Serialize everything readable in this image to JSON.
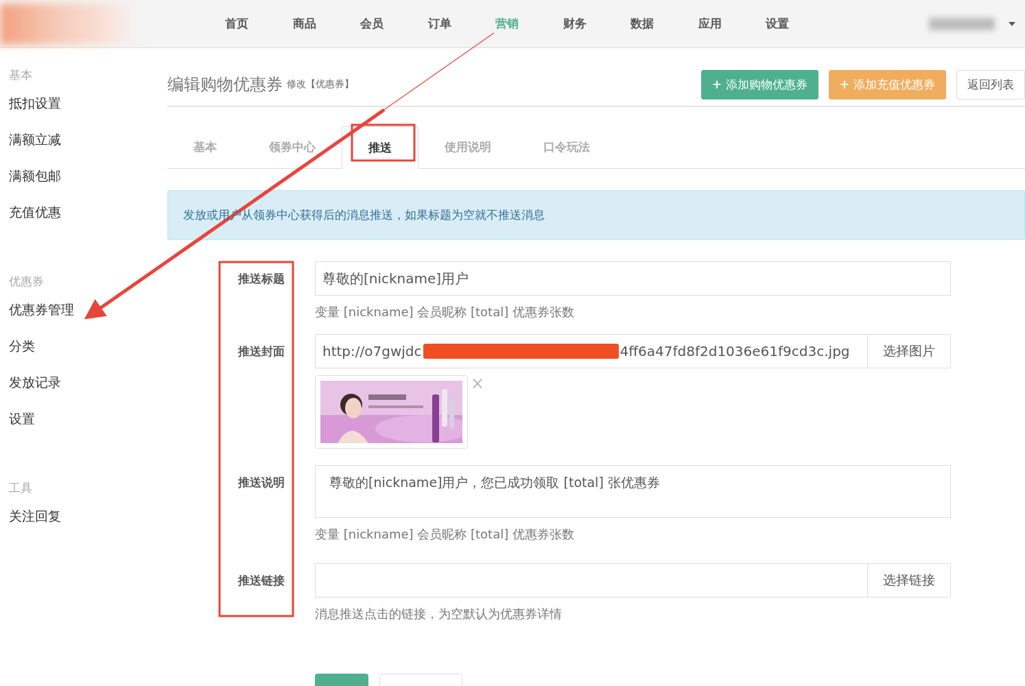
{
  "nav": {
    "items": [
      {
        "label": "首页",
        "selected": false
      },
      {
        "label": "商品",
        "selected": false
      },
      {
        "label": "会员",
        "selected": false
      },
      {
        "label": "订单",
        "selected": false
      },
      {
        "label": "营销",
        "selected": true
      },
      {
        "label": "财务",
        "selected": false
      },
      {
        "label": "数据",
        "selected": false
      },
      {
        "label": "应用",
        "selected": false
      },
      {
        "label": "设置",
        "selected": false
      }
    ]
  },
  "sidebar": {
    "groups": [
      {
        "title": "基本",
        "items": [
          {
            "label": "抵扣设置"
          },
          {
            "label": "满额立减"
          },
          {
            "label": "满额包邮"
          },
          {
            "label": "充值优惠"
          }
        ]
      },
      {
        "title": "优惠券",
        "items": [
          {
            "label": "优惠券管理"
          },
          {
            "label": "分类"
          },
          {
            "label": "发放记录"
          },
          {
            "label": "设置"
          }
        ]
      },
      {
        "title": "工具",
        "items": [
          {
            "label": "关注回复"
          }
        ]
      }
    ]
  },
  "header": {
    "title": "编辑购物优惠券",
    "subtitle": "修改【优惠券】",
    "buttons": [
      {
        "label": "添加购物优惠券",
        "kind": "primary",
        "icon": "+"
      },
      {
        "label": "添加充值优惠券",
        "kind": "warning",
        "icon": "+"
      },
      {
        "label": "返回列表",
        "kind": "default"
      }
    ]
  },
  "tabs": [
    {
      "label": "基本",
      "selected": false
    },
    {
      "label": "领券中心",
      "selected": false
    },
    {
      "label": "推送",
      "selected": true
    },
    {
      "label": "使用说明",
      "selected": false
    },
    {
      "label": "口令玩法",
      "selected": false
    }
  ],
  "alert": "发放或用户从领券中心获得后的消息推送，如果标题为空就不推送消息",
  "form": [
    {
      "label": "推送标题",
      "kind": "text",
      "value": "尊敬的[nickname]用户",
      "help": "变量 [nickname] 会员昵称 [total] 优惠券张数"
    },
    {
      "label": "推送封面",
      "value_parts": [
        "http://o7gwjdc",
        "4ff6a47fd8f2d1036e61f9cd3c.jpg"
      ],
      "button": "选择图片",
      "remove": "×"
    },
    {
      "label": "推送说明",
      "kind": "textarea",
      "value": "尊敬的[nickname]用户，您已成功领取 [total] 张优惠券",
      "help": "变量 [nickname] 会员昵称 [total] 优惠券张数"
    },
    {
      "label": "推送链接",
      "kind": "link",
      "button": "选择链接",
      "help": "消息推送点击的链接，为空默认为优惠券详情"
    }
  ]
}
